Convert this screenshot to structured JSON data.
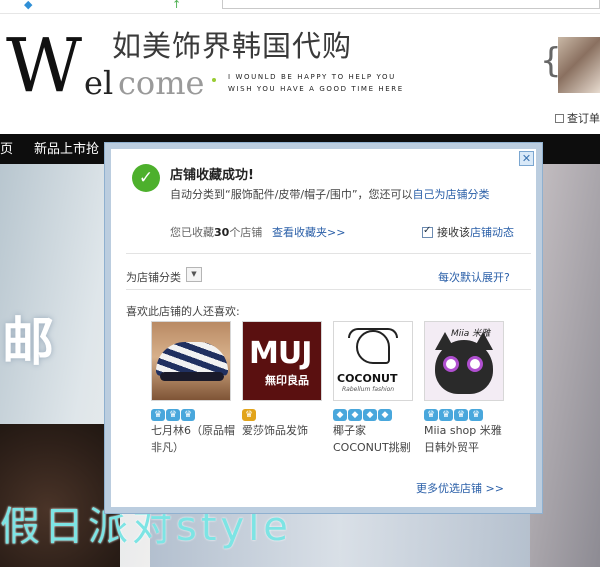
{
  "header": {
    "logo_w": "W",
    "logo_el": "el",
    "logo_come": "come",
    "logo_cn": "如美饰界韩国代购",
    "tagline_1": "I WOUNLD BE HAPPY TO HELP YOU",
    "tagline_2": "WISH YOU HAVE A GOOD TIME HERE",
    "order_link": "查订单"
  },
  "nav": {
    "items": [
      "页",
      "新品上市抢"
    ]
  },
  "background": {
    "overlay_char": "邮",
    "overlay_script": "假日派对style"
  },
  "popup": {
    "close_icon": "close-icon",
    "check_icon": "check-icon",
    "title": "店铺收藏成功!",
    "auto_class_prefix": "自动分类到“服饰配件/皮带/帽子/围巾”，您还可以",
    "auto_class_link": "自己为店铺分类",
    "fav_count_prefix": "您已收藏",
    "fav_count_num": "30",
    "fav_count_suffix": "个店铺",
    "view_fav_link": "查看收藏夹>>",
    "subscribe_label": "接收该",
    "subscribe_link": "店铺动态",
    "subscribe_checked": true,
    "category_label": "为店铺分类",
    "expand_link": "每次默认展开?",
    "also_like_label": "喜欢此店铺的人还喜欢:",
    "shops": [
      {
        "name": "七月林6（原品帽非凡）",
        "crowns": [
          "blue",
          "blue",
          "blue"
        ]
      },
      {
        "name": "爱莎饰品发饰",
        "crowns": [
          "gold"
        ]
      },
      {
        "name": "椰子家COCONUT挑剔的艾瑞克",
        "crowns": [
          "blue",
          "blue",
          "blue",
          "blue"
        ]
      },
      {
        "name": "Miia shop 米雅日韩外贸平",
        "crowns": [
          "blue",
          "blue",
          "blue",
          "blue"
        ]
      }
    ],
    "thumb_texts": {
      "muji_main": "MUJ",
      "muji_sub": "無印良品",
      "coconut": "COCONUT",
      "coconut_sub": "Rabellum fashion",
      "miia": "Miia 米雅"
    },
    "more_shops_link": "更多优选店铺 >>"
  },
  "colors": {
    "nav_bg": "#0d0d0d",
    "link": "#2a5fa8",
    "success_green": "#4db02c",
    "crown_blue": "#49a7dc",
    "crown_gold": "#e2a41a"
  }
}
